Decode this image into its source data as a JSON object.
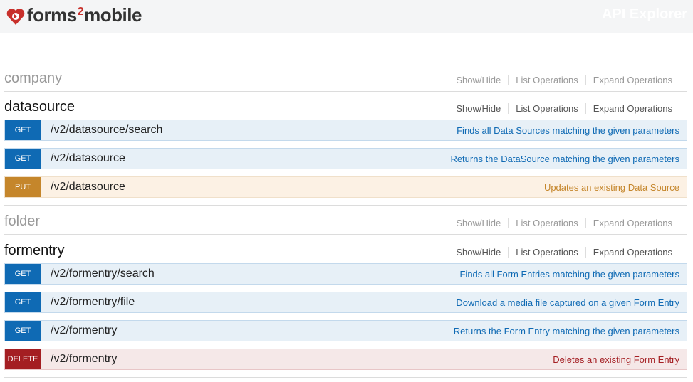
{
  "header": {
    "logo_text_a": "forms",
    "logo_text_two": "2",
    "logo_text_b": "mobile",
    "api_title": "API Explorer"
  },
  "actions": {
    "show_hide": "Show/Hide",
    "list_operations": "List Operations",
    "expand_operations": "Expand Operations"
  },
  "resources": [
    {
      "name": "company",
      "state": "collapsed"
    },
    {
      "name": "datasource",
      "state": "expanded"
    },
    {
      "name": "folder",
      "state": "collapsed"
    },
    {
      "name": "formentry",
      "state": "expanded"
    }
  ],
  "operations": [
    {
      "method": "GET",
      "path": "/v2/datasource/search",
      "summary": "Finds all Data Sources matching the given parameters"
    },
    {
      "method": "GET",
      "path": "/v2/datasource",
      "summary": "Returns the DataSource matching the given parameters"
    },
    {
      "method": "PUT",
      "path": "/v2/datasource",
      "summary": "Updates an existing Data Source"
    },
    {
      "method": "GET",
      "path": "/v2/formentry/search",
      "summary": "Finds all Form Entries matching the given parameters"
    },
    {
      "method": "GET",
      "path": "/v2/formentry/file",
      "summary": "Download a media file captured on a given Form Entry"
    },
    {
      "method": "GET",
      "path": "/v2/formentry",
      "summary": "Returns the Form Entry matching the given parameters"
    },
    {
      "method": "DELETE",
      "path": "/v2/formentry",
      "summary": "Deletes an existing Form Entry"
    }
  ],
  "colors": {
    "get": "#0f6ab4",
    "put": "#c5862b",
    "delete": "#a41e22",
    "logo_accent": "#c8302b"
  },
  "icons": {
    "logo": "forms2mobile-logo-icon"
  }
}
